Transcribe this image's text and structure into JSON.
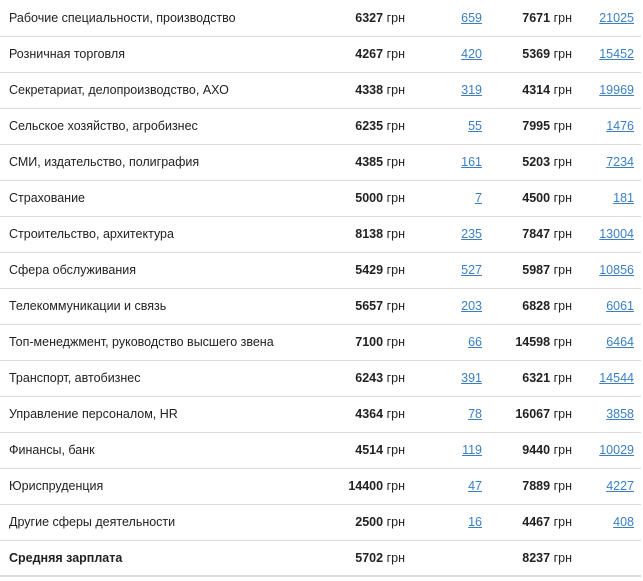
{
  "rows": [
    {
      "category": "Рабочие специальности, производство",
      "salary1": "6327",
      "count1": "659",
      "salary2": "7671",
      "count2": "21025"
    },
    {
      "category": "Розничная торговля",
      "salary1": "4267",
      "count1": "420",
      "salary2": "5369",
      "count2": "15452"
    },
    {
      "category": "Секретариат, делопроизводство, АХО",
      "salary1": "4338",
      "count1": "319",
      "salary2": "4314",
      "count2": "19969"
    },
    {
      "category": "Сельское хозяйство, агробизнес",
      "salary1": "6235",
      "count1": "55",
      "salary2": "7995",
      "count2": "1476"
    },
    {
      "category": "СМИ, издательство, полиграфия",
      "salary1": "4385",
      "count1": "161",
      "salary2": "5203",
      "count2": "7234"
    },
    {
      "category": "Страхование",
      "salary1": "5000",
      "count1": "7",
      "salary2": "4500",
      "count2": "181"
    },
    {
      "category": "Строительство, архитектура",
      "salary1": "8138",
      "count1": "235",
      "salary2": "7847",
      "count2": "13004"
    },
    {
      "category": "Сфера обслуживания",
      "salary1": "5429",
      "count1": "527",
      "salary2": "5987",
      "count2": "10856"
    },
    {
      "category": "Телекоммуникации и связь",
      "salary1": "5657",
      "count1": "203",
      "salary2": "6828",
      "count2": "6061"
    },
    {
      "category": "Топ-менеджмент, руководство высшего звена",
      "salary1": "7100",
      "count1": "66",
      "salary2": "14598",
      "count2": "6464"
    },
    {
      "category": "Транспорт, автобизнес",
      "salary1": "6243",
      "count1": "391",
      "salary2": "6321",
      "count2": "14544"
    },
    {
      "category": "Управление персоналом, HR",
      "salary1": "4364",
      "count1": "78",
      "salary2": "16067",
      "count2": "3858"
    },
    {
      "category": "Финансы, банк",
      "salary1": "4514",
      "count1": "119",
      "salary2": "9440",
      "count2": "10029"
    },
    {
      "category": "Юриспруденция",
      "salary1": "14400",
      "count1": "47",
      "salary2": "7889",
      "count2": "4227"
    },
    {
      "category": "Другие сферы деятельности",
      "salary1": "2500",
      "count1": "16",
      "salary2": "4467",
      "count2": "408"
    }
  ],
  "total": {
    "label": "Средняя зарплата",
    "salary1": "5702",
    "salary2": "8237"
  },
  "currency": "грн",
  "colors": {
    "link": "#3a7fc4",
    "border": "#dcdcdc",
    "text": "#222222"
  }
}
